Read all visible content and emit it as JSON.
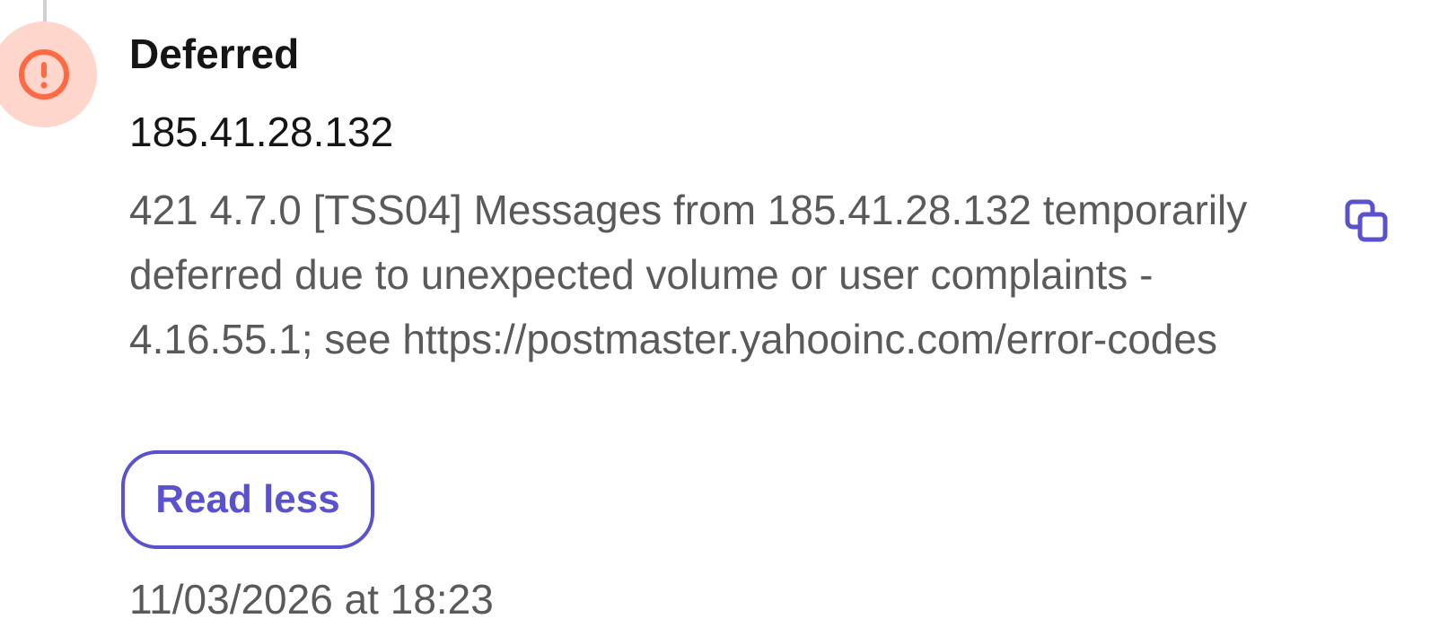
{
  "event": {
    "status": "Deferred",
    "ip": "185.41.28.132",
    "message": "421 4.7.0 [TSS04] Messages from 185.41.28.132 temporarily deferred due to unexpected volume or user complaints - 4.16.55.1; see https://postmaster.yahooinc.com/error-codes",
    "read_less_label": "Read less",
    "timestamp": "11/03/2026 at 18:23"
  },
  "icons": {
    "status": "exclamation-circle-icon",
    "copy": "copy-icon"
  },
  "colors": {
    "status_accent": "#ff6a45",
    "status_bg": "#ffd6cb",
    "link_accent": "#5a51cf",
    "title_text": "#151515",
    "body_text": "#5a5a5a"
  }
}
